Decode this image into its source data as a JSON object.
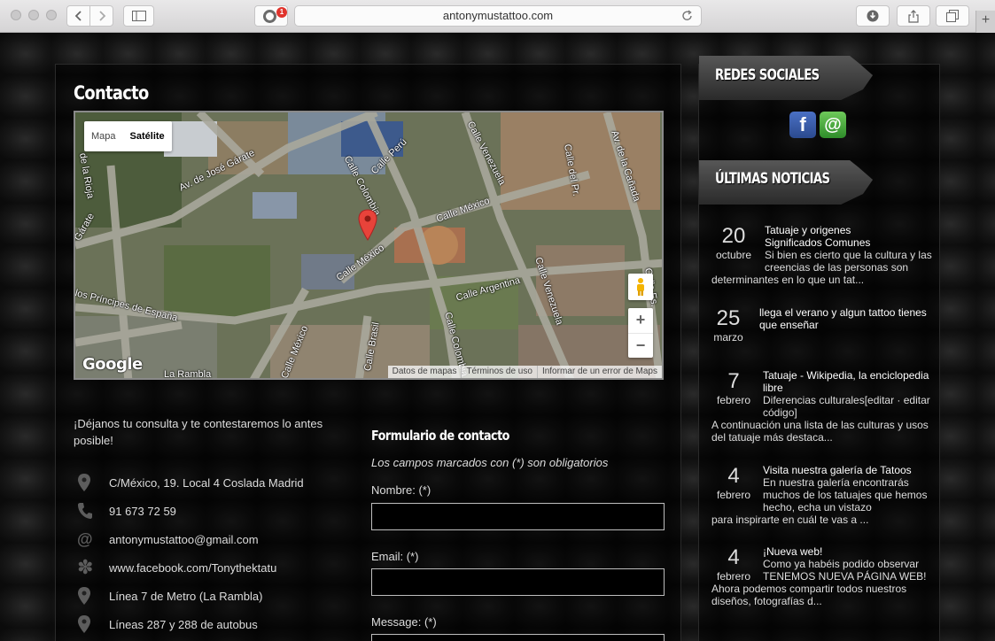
{
  "browser": {
    "url": "antonymustattoo.com",
    "extension_badge": "1"
  },
  "page": {
    "title": "Contacto",
    "map": {
      "type_map": "Mapa",
      "type_satellite": "Satélite",
      "google": "Google",
      "footer": [
        "Datos de mapas",
        "Términos de uso",
        "Informar de un error de Maps"
      ],
      "labels": [
        "Av. de José Gárate",
        "Calle Perú",
        "Calle Colombia",
        "Calle Venezuela",
        "Av. de la Cañada",
        "Calle México",
        "Calle México",
        "Calle Argentina",
        "Calle Venezuela",
        "Calle Brasil",
        "Calle Colombia",
        "Calle México",
        "los Príncipes de España",
        "de la Rioja",
        "Gárate",
        "La Rambla",
        "Calle del Pr.",
        "Calle Es."
      ]
    },
    "intro": "¡Déjanos tu consulta y te contestaremos lo antes posible!",
    "info": [
      {
        "icon": "location-pin-icon",
        "text": "C/México, 19. Local 4 Coslada Madrid"
      },
      {
        "icon": "phone-icon",
        "text": "91 673 72 59"
      },
      {
        "icon": "at-sign-icon",
        "text": "antonymustattoo@gmail.com"
      },
      {
        "icon": "facebook-flower-icon",
        "text": "www.facebook.com/Tonythektatu"
      },
      {
        "icon": "location-pin-icon",
        "text": "Línea 7 de Metro (La Rambla)"
      },
      {
        "icon": "location-pin-icon",
        "text": "Líneas 287 y 288 de autobus"
      }
    ],
    "form": {
      "title": "Formulario de contacto",
      "note": "Los campos marcados con (*) son obligatorios",
      "name_label": "Nombre: (*)",
      "email_label": "Email: (*)",
      "message_label": "Message: (*)"
    }
  },
  "sidebar": {
    "social_title": "REDES SOCIALES",
    "news_title": "ÚLTIMAS NOTICIAS",
    "news": [
      {
        "day": "20",
        "month": "octubre",
        "title": "Tatuaje y origenes",
        "subtitle": "Significados Comunes",
        "excerpt_a": "Si bien es cierto que la cultura y las creencias de las personas son",
        "excerpt_b": "determinantes en lo que un tat..."
      },
      {
        "day": "25",
        "month": "marzo",
        "title": "llega el verano y algun tattoo tienes que enseñar",
        "subtitle": "",
        "excerpt_a": "",
        "excerpt_b": ""
      },
      {
        "day": "7",
        "month": "febrero",
        "title": "Tatuaje - Wikipedia, la enciclopedia libre",
        "subtitle": "",
        "excerpt_a": "Diferencias culturales[editar · editar código]",
        "excerpt_b": "A continuación una lista de las culturas y usos del tatuaje más destaca..."
      },
      {
        "day": "4",
        "month": "febrero",
        "title": "Visita nuestra galería de Tatoos",
        "subtitle": "",
        "excerpt_a": "En nuestra galería encontrarás muchos de los tatuajes que hemos hecho, echa un vistazo",
        "excerpt_b": "para inspirarte en cuál te vas a ..."
      },
      {
        "day": "4",
        "month": "febrero",
        "title": "¡Nueva web!",
        "subtitle": "",
        "excerpt_a": "Como ya habéis podido observar TENEMOS NUEVA PÁGINA WEB!",
        "excerpt_b": "Ahora podemos compartir todos nuestros diseños, fotografías d..."
      }
    ]
  }
}
